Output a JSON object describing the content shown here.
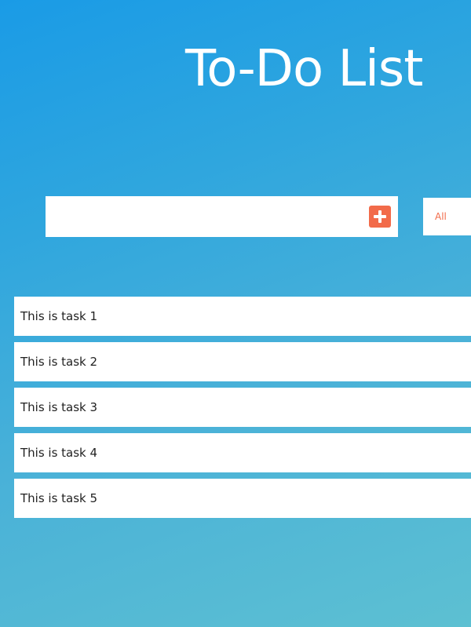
{
  "header": {
    "title": "To-Do List"
  },
  "form": {
    "input_value": "",
    "input_placeholder": "",
    "add_button_icon": "plus-square-icon",
    "filter_selected": "All"
  },
  "tasks": [
    {
      "label": "This is task 1"
    },
    {
      "label": "This is task 2"
    },
    {
      "label": "This is task 3"
    },
    {
      "label": "This is task 4"
    },
    {
      "label": "This is task 5"
    }
  ],
  "colors": {
    "background_start": "#1a9be6",
    "background_end": "#5dc0d2",
    "accent": "#f26b4a",
    "card": "#ffffff",
    "title": "#ffffff"
  }
}
